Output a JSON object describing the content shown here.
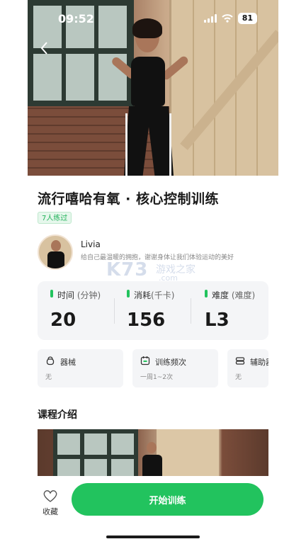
{
  "status_bar": {
    "time": "09:52",
    "battery": "81",
    "signal_icon": "signal-icon",
    "wifi_icon": "wifi-icon"
  },
  "hero": {
    "back_icon": "chevron-left-icon"
  },
  "course": {
    "title": "流行嘻哈有氧 · 核心控制训练",
    "practiced_badge": "7人练过"
  },
  "coach": {
    "name": "Livia",
    "description": "给自己最温暖的拥抱，谢谢身体让我们体验运动的美好"
  },
  "watermark": {
    "logo": "K73",
    "text": "游戏之家",
    "sub": ".com"
  },
  "stats": [
    {
      "label": "时间",
      "unit": "(分钟)",
      "value": "20"
    },
    {
      "label": "消耗",
      "unit": "(千卡)",
      "value": "156"
    },
    {
      "label": "难度",
      "unit": "(难度)",
      "value": "L3"
    }
  ],
  "info_cards": [
    {
      "icon": "kettlebell-icon",
      "label": "器械",
      "value": "无"
    },
    {
      "icon": "calendar-icon",
      "label": "训练频次",
      "value": "一周1~2次"
    },
    {
      "icon": "mat-icon",
      "label": "辅助器",
      "value": "无"
    }
  ],
  "intro": {
    "section_title": "课程介绍"
  },
  "bottom_bar": {
    "favorite_label": "收藏",
    "start_button": "开始训练"
  },
  "colors": {
    "accent": "#22c35e",
    "badge_text": "#22b35a",
    "card_bg": "#f4f5f7"
  }
}
